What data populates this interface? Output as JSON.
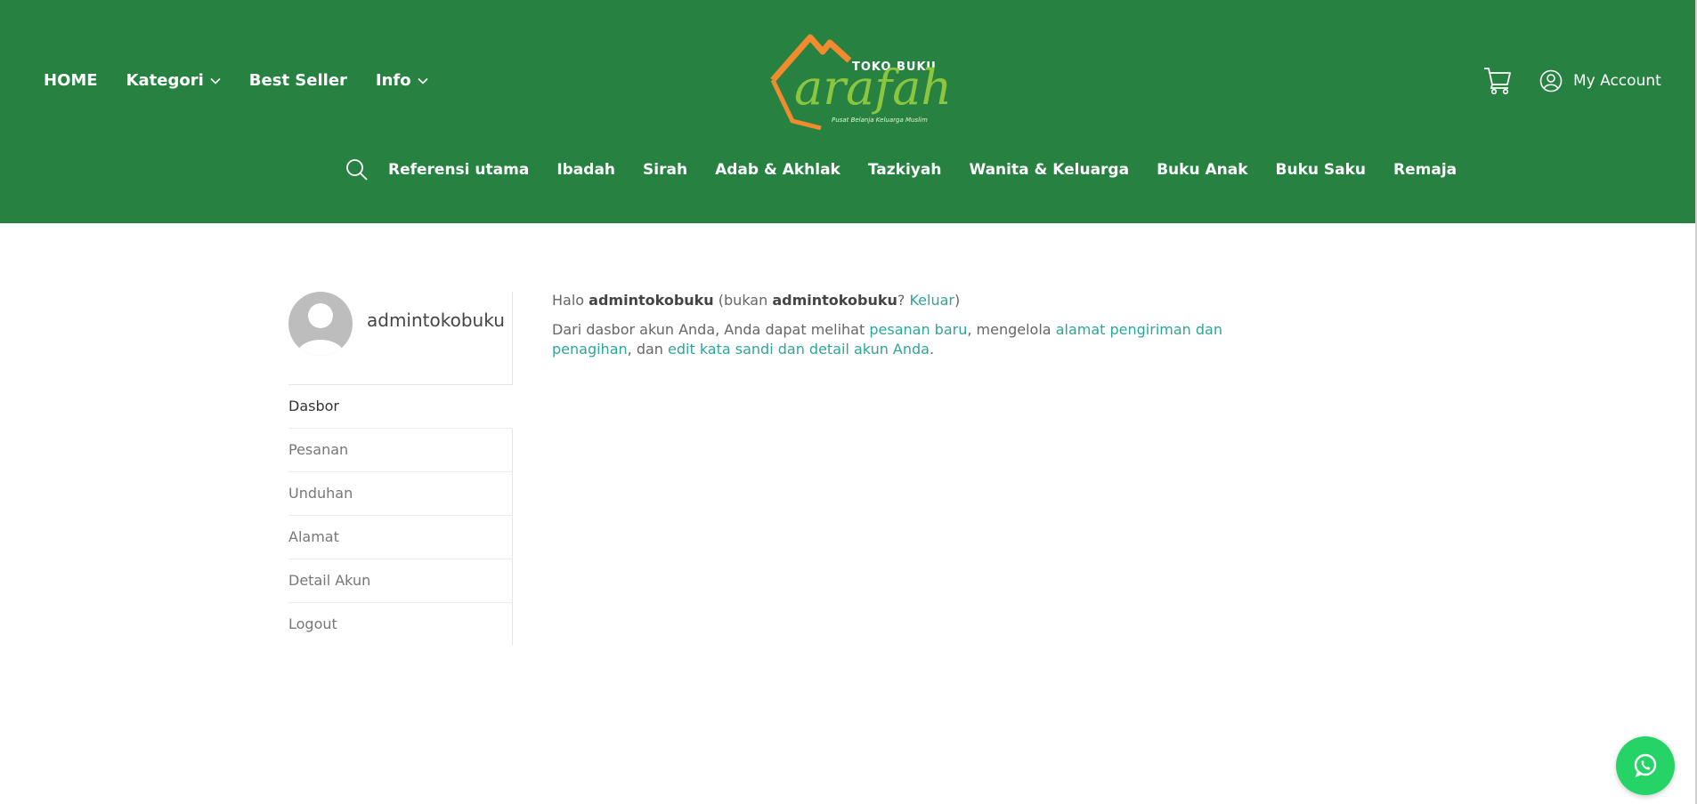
{
  "header": {
    "top_nav": [
      {
        "label": "HOME",
        "has_dropdown": false
      },
      {
        "label": "Kategori",
        "has_dropdown": true
      },
      {
        "label": "Best Seller",
        "has_dropdown": false
      },
      {
        "label": "Info",
        "has_dropdown": true
      }
    ],
    "logo": {
      "top_text": "TOKO BUKU",
      "brand": "arafah",
      "tagline": "Pusat Belanja Keluarga Muslim"
    },
    "cart_icon": "cart-icon",
    "account_label": "My Account",
    "category_nav": [
      "Referensi utama",
      "Ibadah",
      "Sirah",
      "Adab & Akhlak",
      "Tazkiyah",
      "Wanita & Keluarga",
      "Buku Anak",
      "Buku Saku",
      "Remaja"
    ]
  },
  "sidebar": {
    "username": "admintokobuku",
    "menu": [
      "Dasbor",
      "Pesanan",
      "Unduhan",
      "Alamat",
      "Detail Akun",
      "Logout"
    ]
  },
  "main": {
    "greeting_prefix": "Halo",
    "greeting_user": "admintokobuku",
    "greeting_not": "(bukan",
    "greeting_user2": "admintokobuku",
    "greeting_q": "?",
    "logout_link": "Keluar",
    "greeting_close": ")",
    "intro_text": "Dari dasbor akun Anda, Anda dapat melihat",
    "orders_link": "pesanan baru",
    "manage_text": ", mengelola",
    "address_link": "alamat pengiriman dan penagihan",
    "and_text": ", dan",
    "account_link": "edit kata sandi dan detail akun Anda",
    "period": "."
  },
  "colors": {
    "header_bg": "#278242",
    "link": "#2ea59a",
    "logo_orange": "#f28a2e",
    "logo_green": "#8cc63f",
    "whatsapp": "#25d366"
  }
}
